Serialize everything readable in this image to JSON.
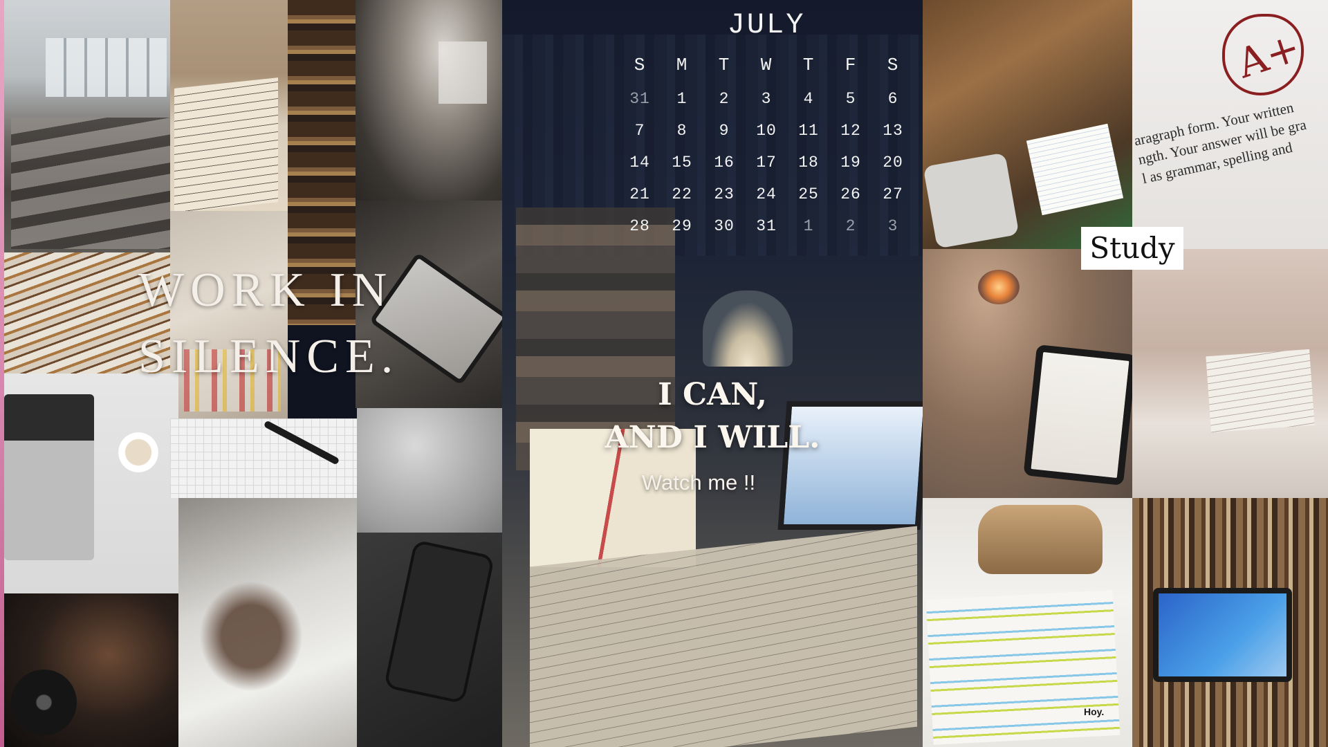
{
  "quotes": {
    "silence_line1": "WORK IN",
    "silence_line2": "SILENCE.",
    "ican_line1": "I CAN,",
    "ican_line2": "AND I WILL.",
    "watch": "Watch me !!"
  },
  "calendar": {
    "month": "JULY",
    "weekdays": [
      "S",
      "M",
      "T",
      "W",
      "T",
      "F",
      "S"
    ],
    "weeks": [
      [
        {
          "d": "31",
          "muted": true
        },
        {
          "d": "1"
        },
        {
          "d": "2"
        },
        {
          "d": "3"
        },
        {
          "d": "4"
        },
        {
          "d": "5"
        },
        {
          "d": "6"
        }
      ],
      [
        {
          "d": "7"
        },
        {
          "d": "8"
        },
        {
          "d": "9"
        },
        {
          "d": "10"
        },
        {
          "d": "11"
        },
        {
          "d": "12"
        },
        {
          "d": "13"
        }
      ],
      [
        {
          "d": "14"
        },
        {
          "d": "15"
        },
        {
          "d": "16"
        },
        {
          "d": "17"
        },
        {
          "d": "18"
        },
        {
          "d": "19"
        },
        {
          "d": "20"
        }
      ],
      [
        {
          "d": "21"
        },
        {
          "d": "22"
        },
        {
          "d": "23"
        },
        {
          "d": "24"
        },
        {
          "d": "25"
        },
        {
          "d": "26"
        },
        {
          "d": "27"
        }
      ],
      [
        {
          "d": "28"
        },
        {
          "d": "29"
        },
        {
          "d": "30"
        },
        {
          "d": "31"
        },
        {
          "d": "1",
          "muted": true
        },
        {
          "d": "2",
          "muted": true
        },
        {
          "d": "3",
          "muted": true
        }
      ]
    ]
  },
  "labels": {
    "study": "Study",
    "grade": "A+",
    "paper_line1": "aragraph form.  Your written",
    "paper_line2": "ngth.  Your answer will be gra",
    "paper_line3": "l as grammar, spelling and",
    "note_hoy": "Hoy."
  },
  "colors": {
    "text_light": "#f4efe9",
    "muted_day": "#9aa0aa",
    "center_panel": "#1a2234",
    "grade_ink": "#8a1f21",
    "study_bg": "#ffffff"
  }
}
